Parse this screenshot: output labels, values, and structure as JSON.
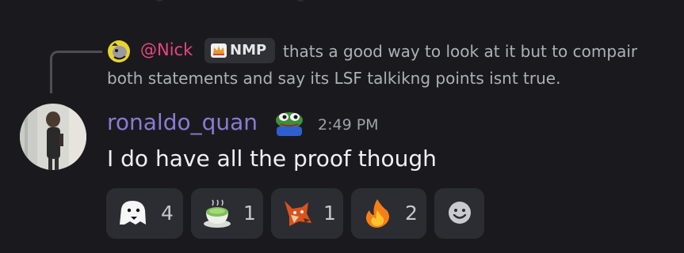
{
  "reply": {
    "mention": "@Nick",
    "tag": "NMP",
    "text": "thats a good way to look at it but to compair both statements and say its LSF talkikng points isnt true."
  },
  "message": {
    "author": "ronaldo_quan",
    "time": "2:49 PM",
    "content": "I do have all the proof though"
  },
  "reactions": [
    {
      "icon": "ghost-face-icon",
      "count": "4"
    },
    {
      "icon": "matcha-tea-icon",
      "count": "1"
    },
    {
      "icon": "fox-face-icon",
      "count": "1"
    },
    {
      "icon": "fire-icon",
      "count": "2"
    }
  ],
  "colors": {
    "background": "#1a1a1e",
    "mention": "#e8467e",
    "author": "#8b7bd4",
    "reaction_bg": "#2c2d32"
  }
}
